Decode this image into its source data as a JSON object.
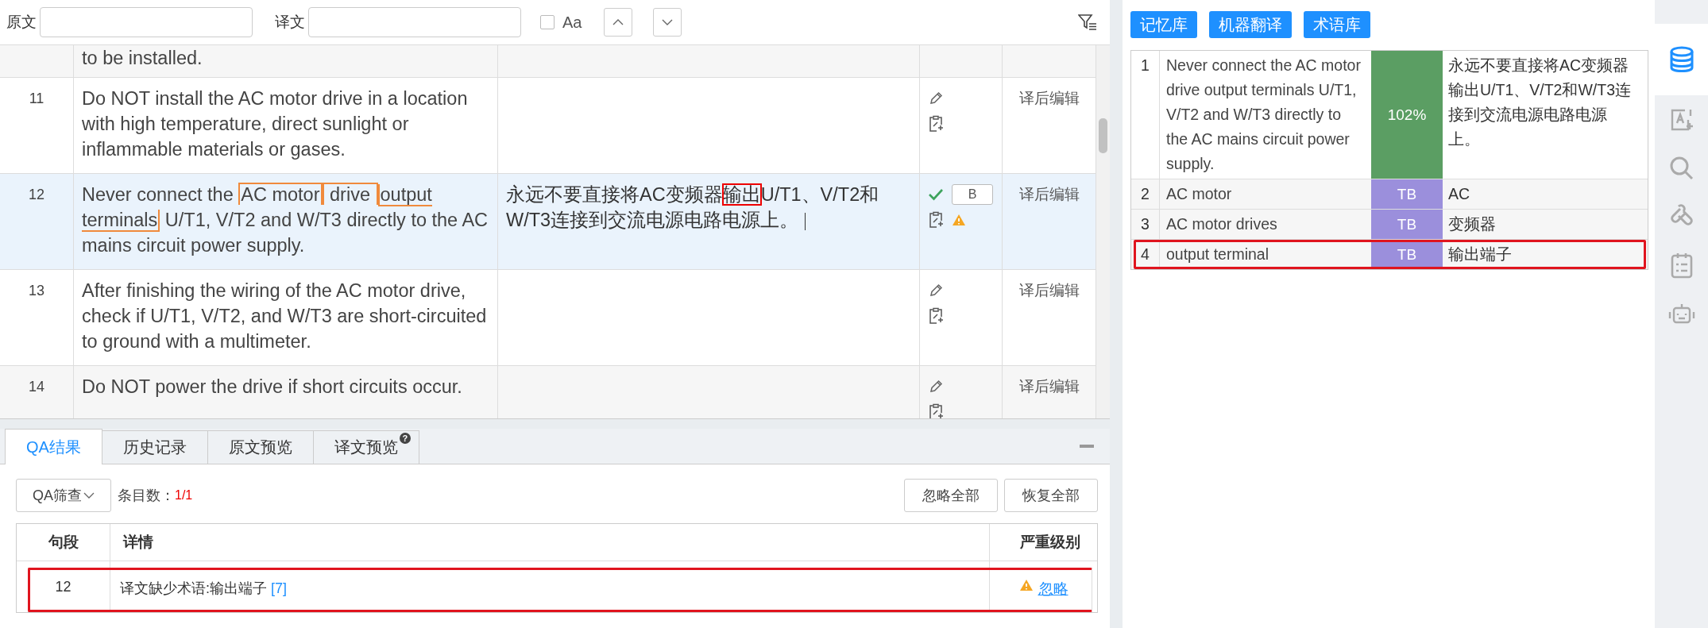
{
  "search_bar": {
    "source_label": "原文",
    "target_label": "译文",
    "case_label": "Aa",
    "case_checked": false
  },
  "segments": [
    {
      "kind": "partial",
      "source": [
        {
          "text": "to be installed.",
          "kind": "plain"
        }
      ]
    },
    {
      "kind": "segment",
      "number": "11",
      "source": [
        {
          "text": "Do NOT install the AC motor drive in a location with high temperature, direct sunlight or inflammable materials or gases.",
          "kind": "plain"
        }
      ],
      "selected": false,
      "confirmed": false,
      "warning": false,
      "status": "译后编辑"
    },
    {
      "kind": "segment",
      "number": "12",
      "source": [
        {
          "text": "Never connect the ",
          "kind": "plain"
        },
        {
          "text": "AC motor",
          "kind": "term_above"
        },
        {
          "text": " drive ",
          "kind": "term_above"
        },
        {
          "text": "output terminals",
          "kind": "term_below"
        },
        {
          "text": " U/T1, V/T2 and W/T3 directly to the AC mains circuit power supply.",
          "kind": "plain"
        }
      ],
      "target": [
        {
          "text": "永远不要直接将AC变频器",
          "highlighted": false
        },
        {
          "text": "输出",
          "highlighted": true
        },
        {
          "text": "U/T1、V/T2和W/T3连接到交流电源电路电源上。",
          "highlighted": false
        }
      ],
      "cursor": true,
      "selected": true,
      "confirmed": true,
      "badge": "B",
      "warning": true,
      "status": "译后编辑"
    },
    {
      "kind": "segment",
      "number": "13",
      "source": [
        {
          "text": "After finishing the wiring of the AC motor drive, check if U/T1, V/T2, and W/T3 are short-circuited to ground with a multimeter.",
          "kind": "plain"
        }
      ],
      "selected": false,
      "confirmed": false,
      "warning": false,
      "status": "译后编辑"
    },
    {
      "kind": "segment",
      "number": "14",
      "source": [
        {
          "text": "Do NOT power the drive if short circuits occur.",
          "kind": "plain"
        }
      ],
      "selected": false,
      "confirmed": false,
      "warning": false,
      "status": "译后编辑"
    }
  ],
  "bottom_tabs": [
    {
      "label": "QA结果",
      "selected": true
    },
    {
      "label": "历史记录",
      "selected": false
    },
    {
      "label": "原文预览",
      "selected": false
    },
    {
      "label": "译文预览",
      "selected": false,
      "badge": "?"
    }
  ],
  "qa": {
    "filter_button": "QA筛查",
    "count_label": "条目数：",
    "count": "1/1",
    "buttons": [
      "忽略全部",
      "恢复全部"
    ],
    "columns": [
      "句段",
      "详情",
      "严重级别"
    ],
    "rows": [
      {
        "segment": "12",
        "detail": "译文缺少术语:输出端子",
        "ref": "[7]",
        "action": "忽略",
        "warning": true,
        "highlighted": true
      }
    ]
  },
  "resource_tabs": [
    "记忆库",
    "机器翻译",
    "术语库"
  ],
  "matches": [
    {
      "number": "1",
      "source": "Never connect the AC motor drive output terminals U/T1, V/T2 and W/T3 directly to the AC mains circuit power supply.",
      "score": "102%",
      "color": "#5b9e63",
      "target": "永远不要直接将AC变频器输出U/T1、V/T2和W/T3连接到交流电源电路电源上。",
      "highlighted": false
    },
    {
      "number": "2",
      "source": "AC motor",
      "score": "TB",
      "color": "#9b8fdc",
      "target": "AC",
      "highlighted": false
    },
    {
      "number": "3",
      "source": "AC motor drives",
      "score": "TB",
      "color": "#9b8fdc",
      "target": "变频器",
      "highlighted": false
    },
    {
      "number": "4",
      "source": "output terminal",
      "score": "TB",
      "color": "#9b8fdc",
      "target": "输出端子",
      "highlighted": true
    }
  ],
  "sidebar": [
    {
      "kind": "database",
      "selected": true
    },
    {
      "kind": "translate",
      "selected": false
    },
    {
      "kind": "search",
      "selected": false
    },
    {
      "kind": "clip",
      "selected": false
    },
    {
      "kind": "list",
      "selected": false
    },
    {
      "kind": "robot",
      "selected": false
    }
  ]
}
